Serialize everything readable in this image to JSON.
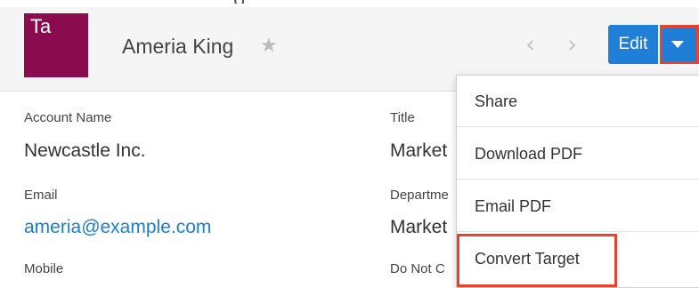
{
  "header": {
    "avatar_initials": "Ta",
    "record_name": "Ameria King",
    "favorite_icon": "star-icon",
    "prev_icon": "chevron-left-icon",
    "next_icon": "chevron-right-icon",
    "edit_label": "Edit",
    "actions_icon": "caret-down-icon"
  },
  "fields": {
    "account_name": {
      "label": "Account Name",
      "value": "Newcastle Inc."
    },
    "title": {
      "label": "Title",
      "value": "Market"
    },
    "email": {
      "label": "Email",
      "value": "ameria@example.com"
    },
    "department": {
      "label": "Departme",
      "value": "Market"
    },
    "mobile": {
      "label": "Mobile"
    },
    "do_not_call": {
      "label": "Do Not C"
    }
  },
  "actions_menu": {
    "items": [
      {
        "label": "Share"
      },
      {
        "label": "Download PDF"
      },
      {
        "label": "Email PDF"
      },
      {
        "label": "Convert Target"
      }
    ]
  },
  "colors": {
    "avatar_bg": "#8a0c4e",
    "primary_button": "#1f7fd6",
    "link": "#1a7fd0",
    "highlight": "#e8432e"
  }
}
